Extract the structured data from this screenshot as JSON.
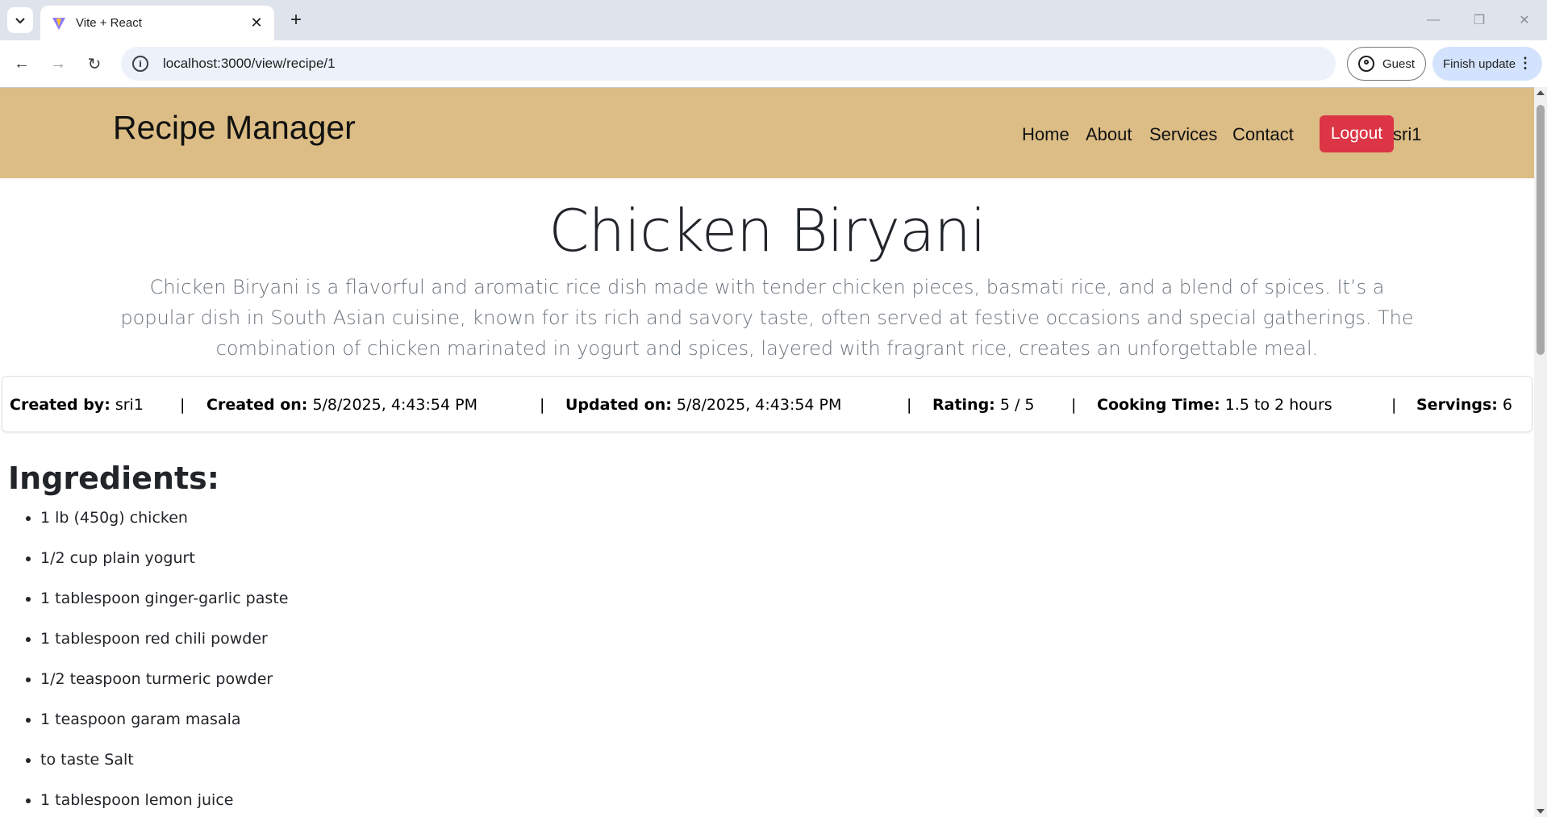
{
  "browser": {
    "tab_title": "Vite + React",
    "url": "localhost:3000/view/recipe/1",
    "guest_label": "Guest",
    "update_label": "Finish update"
  },
  "header": {
    "brand": "Recipe Manager",
    "nav": [
      "Home",
      "About",
      "Services",
      "Contact"
    ],
    "logout_label": "Logout",
    "username": "sri1",
    "background_color": "#dcbd85",
    "logout_color": "#dc3545"
  },
  "recipe": {
    "title": "Chicken Biryani",
    "description": "Chicken Biryani is a flavorful and aromatic rice dish made with tender chicken pieces, basmati rice, and a blend of spices. It’s a popular dish in South Asian cuisine, known for its rich and savory taste, often served at festive occasions and special gatherings. The combination of chicken marinated in yogurt and spices, layered with fragrant rice, creates an unforgettable meal.",
    "meta": {
      "created_by_label": "Created by:",
      "created_by": "sri1",
      "created_on_label": "Created on:",
      "created_on": "5/8/2025, 4:43:54 PM",
      "updated_on_label": "Updated on:",
      "updated_on": "5/8/2025, 4:43:54 PM",
      "rating_label": "Rating:",
      "rating": "5 / 5",
      "cooking_time_label": "Cooking Time:",
      "cooking_time": "1.5 to 2 hours",
      "servings_label": "Servings:",
      "servings": "6",
      "separator": "|"
    },
    "ingredients_title": "Ingredients:",
    "ingredients": [
      "1 lb (450g) chicken",
      "1/2 cup plain yogurt",
      "1 tablespoon ginger-garlic paste",
      "1 tablespoon red chili powder",
      "1/2 teaspoon turmeric powder",
      "1 teaspoon garam masala",
      "to taste Salt",
      "1 tablespoon lemon juice"
    ]
  }
}
